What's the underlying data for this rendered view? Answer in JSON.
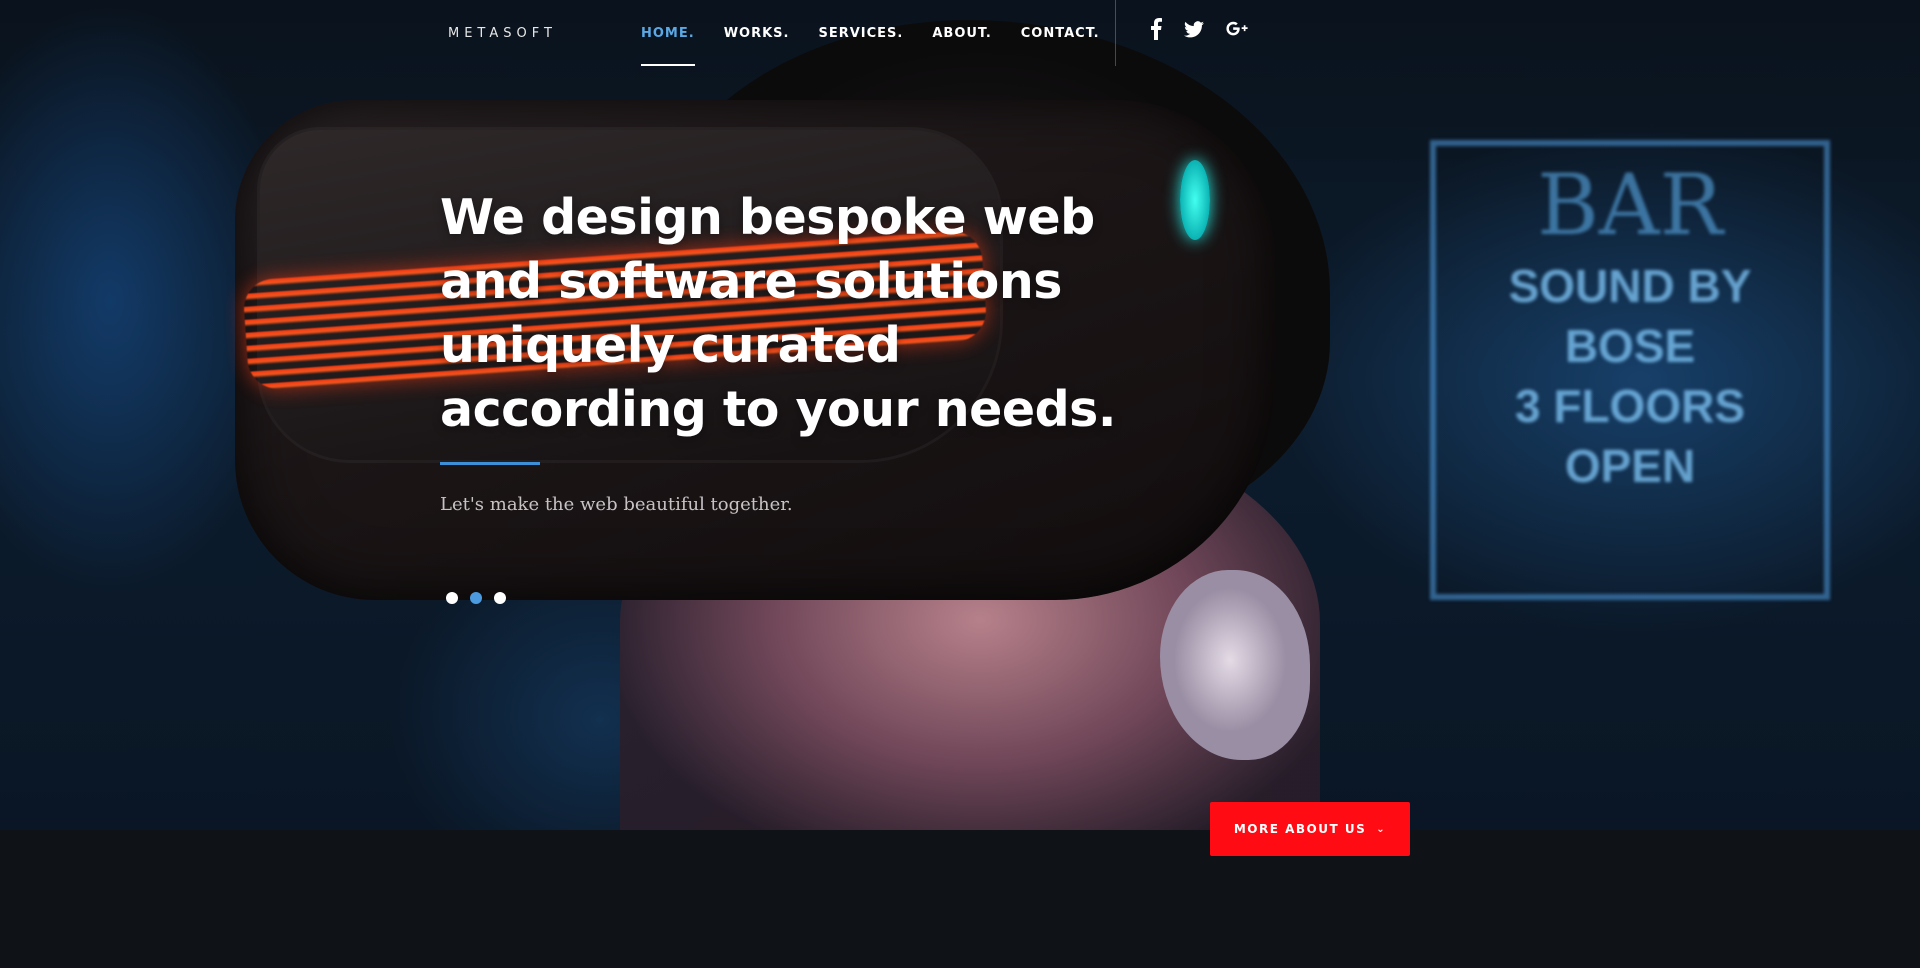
{
  "brand": {
    "logo": "METASOFT"
  },
  "nav": {
    "items": [
      {
        "label": "HOME.",
        "active": true
      },
      {
        "label": "WORKS.",
        "active": false
      },
      {
        "label": "SERVICES.",
        "active": false
      },
      {
        "label": "ABOUT.",
        "active": false
      },
      {
        "label": "CONTACT.",
        "active": false
      }
    ]
  },
  "social": {
    "icons": [
      "facebook-icon",
      "twitter-icon",
      "google-plus-icon"
    ]
  },
  "hero": {
    "headline": "We design bespoke web and software solutions uniquely curated according to your needs.",
    "subline": "Let's make the web beautiful together.",
    "slider": {
      "total": 3,
      "active_index": 1
    },
    "cta_label": "MORE ABOUT US",
    "cta_icon": "chevron-down-icon"
  },
  "colors": {
    "accent_blue": "#5aa9e6",
    "cta_red": "#ff0b14",
    "page_bg": "#0f1217"
  }
}
